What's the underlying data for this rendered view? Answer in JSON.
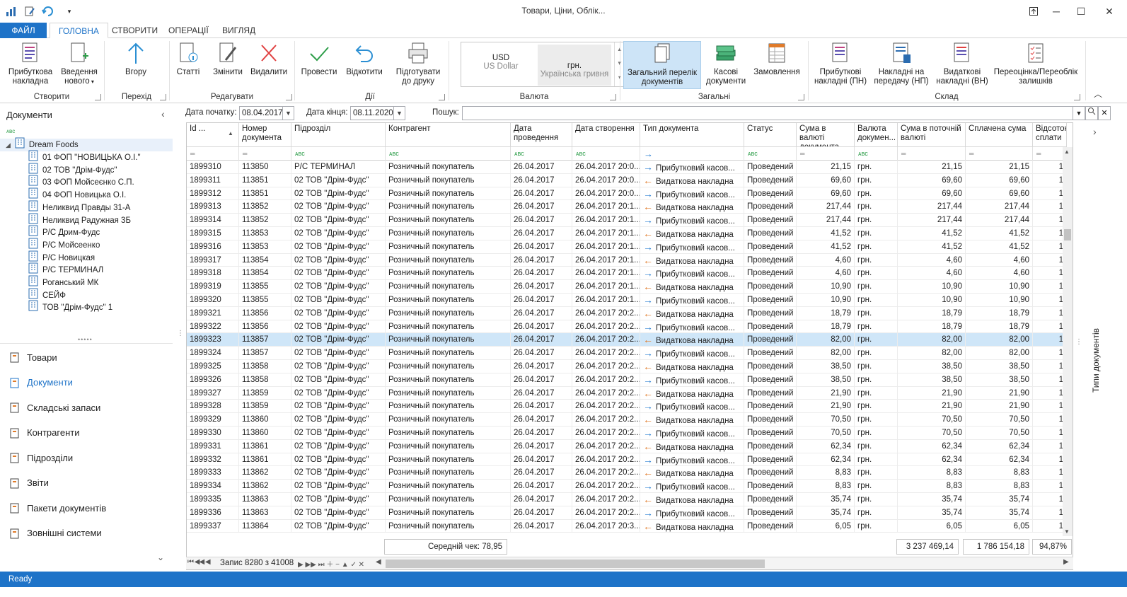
{
  "window": {
    "title": "Товари, Ціни, Облік..."
  },
  "tabs": {
    "file": "ФАЙЛ",
    "items": [
      "ГОЛОВНА",
      "СТВОРИТИ",
      "ОПЕРАЦІЇ",
      "ВИГЛЯД"
    ]
  },
  "ribbon": {
    "buttons": {
      "income": "Прибуткова накладна",
      "input_new": "Введення нового",
      "up": "Вгору",
      "articles": "Статті",
      "edit": "Змінити",
      "delete": "Видалити",
      "post": "Провести",
      "rollback": "Відкотити",
      "print_prepare": "Підготувати до друку",
      "general_list": "Загальний перелік документів",
      "cash_docs": "Касові документи",
      "orders": "Замовлення",
      "income_pn": "Прибуткові накладні (ПН)",
      "transfer_np": "Накладні на передачу (НП)",
      "outgoing_vn": "Видаткові накладні (ВН)",
      "revaluation": "Переоцінка/Переоблік залишків"
    },
    "groups": {
      "create": "Створити",
      "nav": "Перехід",
      "edit": "Редагувати",
      "actions": "Дії",
      "currency": "Валюта",
      "general": "Загальні",
      "warehouse": "Склад"
    },
    "currency": {
      "code1": "USD",
      "name1": "US Dollar",
      "code2": "грн.",
      "name2": "Українська гривня"
    }
  },
  "left": {
    "title": "Документи",
    "root": "Dream Foods",
    "tree": [
      "01 ФОП \"НОВИЦЬКА О.І.\"",
      "02 ТОВ \"Дрім-Фудс\"",
      "03 ФОП Мойсеєнко С.П.",
      "04 ФОП Новицька О.І.",
      "Неликвид Правды 31-А",
      "Неликвид Радужная 3Б",
      "Р/С Дрим-Фудс",
      "Р/С Мойсеенко",
      "Р/С Новицкая",
      "Р/С ТЕРМИНАЛ",
      "Роганський МК",
      "СЕЙФ",
      "ТОВ \"Дрім-Фудс\" 1"
    ],
    "nav": [
      "Товари",
      "Документи",
      "Складські запаси",
      "Контрагенти",
      "Підрозділи",
      "Звіти",
      "Пакети документів",
      "Зовнішні системи"
    ]
  },
  "filter": {
    "start_label": "Дата початку:",
    "start_value": "08.04.2017",
    "end_label": "Дата кінця:",
    "end_value": "08.11.2020",
    "search_label": "Пошук:"
  },
  "grid": {
    "columns": [
      "Id ...",
      "Номер документа",
      "Підрозділ",
      "Контрагент",
      "Дата проведення",
      "Дата створення",
      "Тип документа",
      "Статус",
      "Сума в валюті документа",
      "Валюта докумен...",
      "Сума в поточній валюті",
      "Сплачена сума",
      "Відсоток сплати"
    ],
    "rows": [
      [
        "1899310",
        "113850",
        "Р/С ТЕРМИНАЛ",
        "Розничный покупатель",
        "26.04.2017",
        "26.04.2017 20:0...",
        "in",
        "Прибутковий касов...",
        "Проведений",
        "21,15",
        "грн.",
        "21,15",
        "21,15",
        "1"
      ],
      [
        "1899311",
        "113851",
        "02 ТОВ \"Дрім-Фудс\"",
        "Розничный покупатель",
        "26.04.2017",
        "26.04.2017 20:0...",
        "out",
        "Видаткова накладна",
        "Проведений",
        "69,60",
        "грн.",
        "69,60",
        "69,60",
        "1"
      ],
      [
        "1899312",
        "113851",
        "02 ТОВ \"Дрім-Фудс\"",
        "Розничный покупатель",
        "26.04.2017",
        "26.04.2017 20:0...",
        "in",
        "Прибутковий касов...",
        "Проведений",
        "69,60",
        "грн.",
        "69,60",
        "69,60",
        "1"
      ],
      [
        "1899313",
        "113852",
        "02 ТОВ \"Дрім-Фудс\"",
        "Розничный покупатель",
        "26.04.2017",
        "26.04.2017 20:1...",
        "out",
        "Видаткова накладна",
        "Проведений",
        "217,44",
        "грн.",
        "217,44",
        "217,44",
        "1"
      ],
      [
        "1899314",
        "113852",
        "02 ТОВ \"Дрім-Фудс\"",
        "Розничный покупатель",
        "26.04.2017",
        "26.04.2017 20:1...",
        "in",
        "Прибутковий касов...",
        "Проведений",
        "217,44",
        "грн.",
        "217,44",
        "217,44",
        "1"
      ],
      [
        "1899315",
        "113853",
        "02 ТОВ \"Дрім-Фудс\"",
        "Розничный покупатель",
        "26.04.2017",
        "26.04.2017 20:1...",
        "out",
        "Видаткова накладна",
        "Проведений",
        "41,52",
        "грн.",
        "41,52",
        "41,52",
        "1"
      ],
      [
        "1899316",
        "113853",
        "02 ТОВ \"Дрім-Фудс\"",
        "Розничный покупатель",
        "26.04.2017",
        "26.04.2017 20:1...",
        "in",
        "Прибутковий касов...",
        "Проведений",
        "41,52",
        "грн.",
        "41,52",
        "41,52",
        "1"
      ],
      [
        "1899317",
        "113854",
        "02 ТОВ \"Дрім-Фудс\"",
        "Розничный покупатель",
        "26.04.2017",
        "26.04.2017 20:1...",
        "out",
        "Видаткова накладна",
        "Проведений",
        "4,60",
        "грн.",
        "4,60",
        "4,60",
        "1"
      ],
      [
        "1899318",
        "113854",
        "02 ТОВ \"Дрім-Фудс\"",
        "Розничный покупатель",
        "26.04.2017",
        "26.04.2017 20:1...",
        "in",
        "Прибутковий касов...",
        "Проведений",
        "4,60",
        "грн.",
        "4,60",
        "4,60",
        "1"
      ],
      [
        "1899319",
        "113855",
        "02 ТОВ \"Дрім-Фудс\"",
        "Розничный покупатель",
        "26.04.2017",
        "26.04.2017 20:1...",
        "out",
        "Видаткова накладна",
        "Проведений",
        "10,90",
        "грн.",
        "10,90",
        "10,90",
        "1"
      ],
      [
        "1899320",
        "113855",
        "02 ТОВ \"Дрім-Фудс\"",
        "Розничный покупатель",
        "26.04.2017",
        "26.04.2017 20:1...",
        "in",
        "Прибутковий касов...",
        "Проведений",
        "10,90",
        "грн.",
        "10,90",
        "10,90",
        "1"
      ],
      [
        "1899321",
        "113856",
        "02 ТОВ \"Дрім-Фудс\"",
        "Розничный покупатель",
        "26.04.2017",
        "26.04.2017 20:2...",
        "out",
        "Видаткова накладна",
        "Проведений",
        "18,79",
        "грн.",
        "18,79",
        "18,79",
        "1"
      ],
      [
        "1899322",
        "113856",
        "02 ТОВ \"Дрім-Фудс\"",
        "Розничный покупатель",
        "26.04.2017",
        "26.04.2017 20:2...",
        "in",
        "Прибутковий касов...",
        "Проведений",
        "18,79",
        "грн.",
        "18,79",
        "18,79",
        "1"
      ],
      [
        "1899323",
        "113857",
        "02 ТОВ \"Дрім-Фудс\"",
        "Розничный покупатель",
        "26.04.2017",
        "26.04.2017 20:2...",
        "out",
        "Видаткова накладна",
        "Проведений",
        "82,00",
        "грн.",
        "82,00",
        "82,00",
        "1"
      ],
      [
        "1899324",
        "113857",
        "02 ТОВ \"Дрім-Фудс\"",
        "Розничный покупатель",
        "26.04.2017",
        "26.04.2017 20:2...",
        "in",
        "Прибутковий касов...",
        "Проведений",
        "82,00",
        "грн.",
        "82,00",
        "82,00",
        "1"
      ],
      [
        "1899325",
        "113858",
        "02 ТОВ \"Дрім-Фудс\"",
        "Розничный покупатель",
        "26.04.2017",
        "26.04.2017 20:2...",
        "out",
        "Видаткова накладна",
        "Проведений",
        "38,50",
        "грн.",
        "38,50",
        "38,50",
        "1"
      ],
      [
        "1899326",
        "113858",
        "02 ТОВ \"Дрім-Фудс\"",
        "Розничный покупатель",
        "26.04.2017",
        "26.04.2017 20:2...",
        "in",
        "Прибутковий касов...",
        "Проведений",
        "38,50",
        "грн.",
        "38,50",
        "38,50",
        "1"
      ],
      [
        "1899327",
        "113859",
        "02 ТОВ \"Дрім-Фудс\"",
        "Розничный покупатель",
        "26.04.2017",
        "26.04.2017 20:2...",
        "out",
        "Видаткова накладна",
        "Проведений",
        "21,90",
        "грн.",
        "21,90",
        "21,90",
        "1"
      ],
      [
        "1899328",
        "113859",
        "02 ТОВ \"Дрім-Фудс\"",
        "Розничный покупатель",
        "26.04.2017",
        "26.04.2017 20:2...",
        "in",
        "Прибутковий касов...",
        "Проведений",
        "21,90",
        "грн.",
        "21,90",
        "21,90",
        "1"
      ],
      [
        "1899329",
        "113860",
        "02 ТОВ \"Дрім-Фудс\"",
        "Розничный покупатель",
        "26.04.2017",
        "26.04.2017 20:2...",
        "out",
        "Видаткова накладна",
        "Проведений",
        "70,50",
        "грн.",
        "70,50",
        "70,50",
        "1"
      ],
      [
        "1899330",
        "113860",
        "02 ТОВ \"Дрім-Фудс\"",
        "Розничный покупатель",
        "26.04.2017",
        "26.04.2017 20:2...",
        "in",
        "Прибутковий касов...",
        "Проведений",
        "70,50",
        "грн.",
        "70,50",
        "70,50",
        "1"
      ],
      [
        "1899331",
        "113861",
        "02 ТОВ \"Дрім-Фудс\"",
        "Розничный покупатель",
        "26.04.2017",
        "26.04.2017 20:2...",
        "out",
        "Видаткова накладна",
        "Проведений",
        "62,34",
        "грн.",
        "62,34",
        "62,34",
        "1"
      ],
      [
        "1899332",
        "113861",
        "02 ТОВ \"Дрім-Фудс\"",
        "Розничный покупатель",
        "26.04.2017",
        "26.04.2017 20:2...",
        "in",
        "Прибутковий касов...",
        "Проведений",
        "62,34",
        "грн.",
        "62,34",
        "62,34",
        "1"
      ],
      [
        "1899333",
        "113862",
        "02 ТОВ \"Дрім-Фудс\"",
        "Розничный покупатель",
        "26.04.2017",
        "26.04.2017 20:2...",
        "out",
        "Видаткова накладна",
        "Проведений",
        "8,83",
        "грн.",
        "8,83",
        "8,83",
        "1"
      ],
      [
        "1899334",
        "113862",
        "02 ТОВ \"Дрім-Фудс\"",
        "Розничный покупатель",
        "26.04.2017",
        "26.04.2017 20:2...",
        "in",
        "Прибутковий касов...",
        "Проведений",
        "8,83",
        "грн.",
        "8,83",
        "8,83",
        "1"
      ],
      [
        "1899335",
        "113863",
        "02 ТОВ \"Дрім-Фудс\"",
        "Розничный покупатель",
        "26.04.2017",
        "26.04.2017 20:2...",
        "out",
        "Видаткова накладна",
        "Проведений",
        "35,74",
        "грн.",
        "35,74",
        "35,74",
        "1"
      ],
      [
        "1899336",
        "113863",
        "02 ТОВ \"Дрім-Фудс\"",
        "Розничный покупатель",
        "26.04.2017",
        "26.04.2017 20:2...",
        "in",
        "Прибутковий касов...",
        "Проведений",
        "35,74",
        "грн.",
        "35,74",
        "35,74",
        "1"
      ],
      [
        "1899337",
        "113864",
        "02 ТОВ \"Дрім-Фудс\"",
        "Розничный покупатель",
        "26.04.2017",
        "26.04.2017 20:3...",
        "out",
        "Видаткова накладна",
        "Проведений",
        "6,05",
        "грн.",
        "6,05",
        "6,05",
        "1"
      ]
    ],
    "selected_id": "1899323"
  },
  "footer": {
    "avg_check": "Середній чек: 78,95",
    "sum_total": "3 237 469,14",
    "paid_total": "1 786 154,18",
    "percent": "94,87%",
    "record": "Запис 8280 з 41008"
  },
  "right_panel": {
    "label": "Типи документів"
  },
  "status": {
    "text": "Ready"
  },
  "colors": {
    "accent": "#1e73c8",
    "selection": "#cfe6f8",
    "arrow_in": "#2b7fd3",
    "arrow_out": "#e07b2a"
  }
}
